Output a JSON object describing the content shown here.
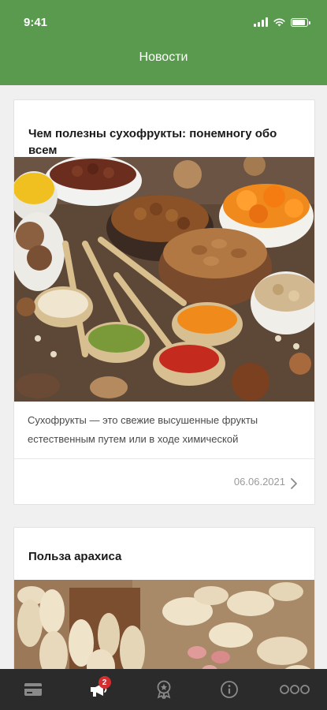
{
  "status_bar": {
    "time": "9:41"
  },
  "header": {
    "title": "Новости"
  },
  "articles": [
    {
      "title": "Чем полезны сухофрукты: понемногу обо всем",
      "excerpt": "Сухофрукты — это свежие высушенные фрукты естественным путем или в ходе химической",
      "date": "06.06.2021"
    },
    {
      "title": "Польза арахиса"
    }
  ],
  "tabbar": {
    "items": [
      {
        "icon": "card-icon"
      },
      {
        "icon": "megaphone-icon",
        "badge": "2"
      },
      {
        "icon": "award-icon"
      },
      {
        "icon": "info-icon"
      },
      {
        "icon": "more-icon"
      }
    ]
  }
}
